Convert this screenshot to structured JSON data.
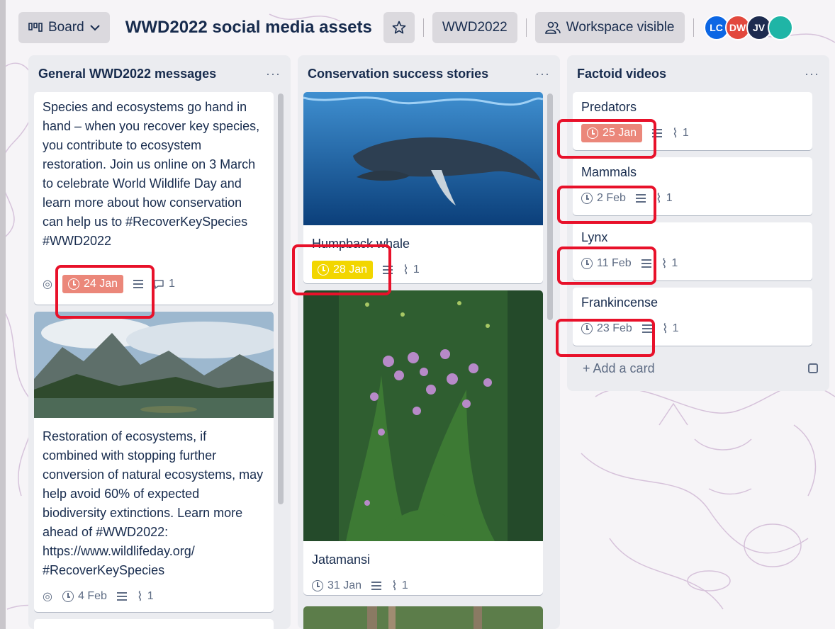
{
  "header": {
    "board_switch_label": "Board",
    "board_title": "WWD2022 social media assets",
    "workspace_name": "WWD2022",
    "visibility_label": "Workspace visible",
    "members": [
      {
        "initials": "LC",
        "color": "#0c66e4"
      },
      {
        "initials": "DW",
        "color": "#e2483d"
      },
      {
        "initials": "JV",
        "color": "#1d2b4f"
      }
    ]
  },
  "lists": [
    {
      "title": "General WWD2022 messages",
      "menu": "···",
      "cards": [
        {
          "text": "Species and ecosystems go hand in hand – when you recover key species, you contribute to ecosystem restoration. Join us online on 3 March to celebrate World Wildlife Day and learn more about how conservation can help us to #RecoverKeySpecies #WWD2022",
          "due": "24 Jan",
          "due_status": "overdue",
          "comments": "1"
        },
        {
          "text": "Restoration of ecosystems, if combined with stopping further conversion of natural ecosystems, may help avoid 60% of expected biodiversity extinctions. Learn more ahead of #WWD2022: https://www.wildlifeday.org/ #RecoverKeySpecies",
          "due": "4 Feb",
          "due_status": "normal",
          "attachments": "1"
        }
      ]
    },
    {
      "title": "Conservation success stories",
      "menu": "···",
      "cards": [
        {
          "title": "Humpback whale",
          "due": "28 Jan",
          "due_status": "due-soon",
          "attachments": "1"
        },
        {
          "title": "Jatamansi",
          "due": "31 Jan",
          "due_status": "normal",
          "attachments": "1"
        }
      ]
    },
    {
      "title": "Factoid videos",
      "menu": "···",
      "cards": [
        {
          "title": "Predators",
          "due": "25 Jan",
          "due_status": "overdue",
          "attachments": "1"
        },
        {
          "title": "Mammals",
          "due": "2 Feb",
          "due_status": "normal",
          "attachments": "1"
        },
        {
          "title": "Lynx",
          "due": "11 Feb",
          "due_status": "normal",
          "attachments": "1"
        },
        {
          "title": "Frankincense",
          "due": "23 Feb",
          "due_status": "normal",
          "attachments": "1"
        }
      ],
      "add_card_label": "+ Add a card"
    }
  ],
  "colors": {
    "overdue": "#eb877a",
    "due_soon": "#f2d600",
    "highlight": "#e8112a",
    "list_bg": "#ebecf0"
  }
}
